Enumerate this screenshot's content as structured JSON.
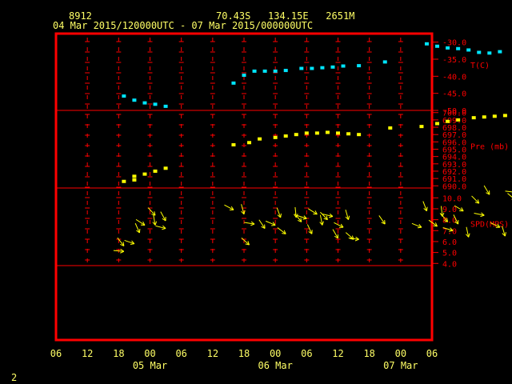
{
  "header": {
    "station": "8912",
    "location": "70.43S   134.15E   2651M",
    "period": "04 Mar 2015/120000UTC - 07 Mar 2015/000000UTC"
  },
  "footer_label": "2",
  "colors": {
    "background": "#000000",
    "frame": "#ff0000",
    "header_text": "#ffff66",
    "temperature": "#00e5ff",
    "pressure": "#ffff00",
    "wind": "#ffff00"
  },
  "chart_data": [
    {
      "type": "scatter",
      "panel": "temperature",
      "ylabel": "T(C)",
      "ylim": [
        -50,
        -27.5
      ],
      "yticks": [
        "-30.0",
        "-35.0",
        "-40.0",
        "-45.0",
        "-50.0"
      ],
      "x_unit": "hours from 04 Mar 2015 06UTC",
      "series": [
        {
          "x": [
            13,
            15,
            17,
            19,
            21,
            34,
            36,
            38,
            40,
            42,
            44,
            47,
            49,
            51,
            53,
            55,
            58,
            63,
            71,
            73,
            75,
            77,
            79,
            81,
            83,
            85
          ],
          "values": [
            -45.8,
            -47.0,
            -47.8,
            -48.2,
            -48.8,
            -42.0,
            -39.7,
            -38.5,
            -38.5,
            -38.5,
            -38.3,
            -37.7,
            -37.7,
            -37.5,
            -37.3,
            -37.0,
            -36.9,
            -35.8,
            -30.5,
            -31.2,
            -31.7,
            -31.9,
            -32.3,
            -33.0,
            -33.2,
            -32.8
          ]
        }
      ]
    },
    {
      "type": "scatter",
      "panel": "pressure",
      "ylabel": "Pre (mb)",
      "ylim": [
        689.7,
        700.3
      ],
      "yticks": [
        "700.0",
        "699.0",
        "698.0",
        "697.0",
        "696.0",
        "695.0",
        "694.0",
        "693.0",
        "692.0",
        "691.0",
        "690.0"
      ],
      "x_unit": "hours from 04 Mar 2015 06UTC",
      "series": [
        {
          "x": [
            13,
            15,
            15,
            17,
            19,
            21,
            34,
            37,
            39,
            42,
            44,
            46,
            48,
            50,
            52,
            54,
            56,
            58,
            64,
            70,
            73,
            75,
            77,
            80,
            82,
            84,
            86,
            88,
            90,
            92
          ],
          "values": [
            690.6,
            690.8,
            691.3,
            691.6,
            692.0,
            692.4,
            695.6,
            695.9,
            696.4,
            696.6,
            696.8,
            697.0,
            697.2,
            697.2,
            697.3,
            697.2,
            697.1,
            697.0,
            697.9,
            698.1,
            698.5,
            698.8,
            699.0,
            699.3,
            699.4,
            699.5,
            699.6,
            699.7,
            699.8,
            700.0
          ]
        }
      ]
    },
    {
      "type": "scatter",
      "panel": "wind",
      "ylabel": "SPD(MPS)",
      "ylim": [
        3.8,
        10.9
      ],
      "yticks": [
        "10.0",
        "9.0",
        "8.0",
        "7.0",
        "6.0",
        "5.0",
        "4.0"
      ],
      "x_unit": "hours from 04 Mar 2015 06UTC",
      "series": [
        {
          "x": [
            13,
            13,
            15,
            16,
            17,
            19,
            19,
            21,
            21,
            34,
            36,
            37,
            38,
            40,
            42,
            43,
            44,
            46,
            47,
            48,
            49,
            50,
            51,
            52,
            53,
            54,
            55,
            56,
            57,
            58,
            63,
            70,
            71,
            73,
            74,
            75,
            76,
            77,
            78,
            79,
            81,
            82,
            83,
            85,
            86,
            88,
            88,
            90,
            91,
            92
          ],
          "values": [
            5.1,
            5.6,
            5.8,
            6.8,
            7.5,
            7.5,
            8.4,
            7.2,
            7.9,
            8.9,
            8.5,
            5.7,
            7.6,
            7.2,
            7.5,
            8.2,
            6.7,
            8.2,
            7.8,
            8.1,
            6.7,
            8.5,
            7.5,
            8.0,
            8.3,
            6.3,
            7.3,
            8.0,
            6.2,
            6.2,
            7.6,
            7.3,
            8.8,
            7.4,
            8.3,
            7.8,
            7.0,
            7.6,
            8.8,
            6.4,
            9.5,
            8.4,
            10.3,
            7.3,
            6.5,
            9.8,
            10.5,
            7.1,
            8.9,
            7.7
          ]
        }
      ]
    }
  ],
  "x_axis": {
    "hour_labels": [
      "06",
      "12",
      "18",
      "00",
      "06",
      "12",
      "18",
      "00",
      "06",
      "12",
      "18",
      "00",
      "06"
    ],
    "date_labels": [
      "05 Mar",
      "06 Mar",
      "07 Mar"
    ]
  }
}
